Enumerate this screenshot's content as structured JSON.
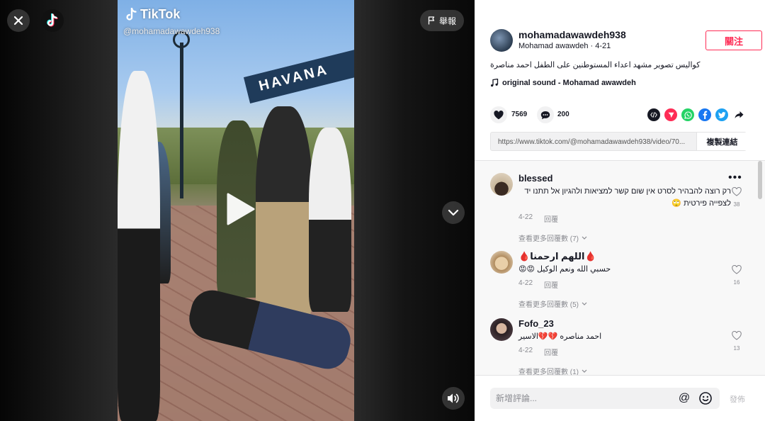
{
  "video": {
    "watermark_brand": "TikTok",
    "watermark_user": "@mohamadawawdeh938",
    "banner_text": "HAVANA",
    "report_label": "舉報"
  },
  "post": {
    "author_username": "mohamadawawdeh938",
    "author_display": "Mohamad awawdeh · 4-21",
    "follow_label": "關注",
    "caption": "كواليس تصوير مشهد اعداء المستوطنين على الطفل احمد مناصرة",
    "music": "original sound - Mohamad awawdeh",
    "likes": "7569",
    "comments": "200",
    "link_url": "https://www.tiktok.com/@mohamadawawdeh938/video/70...",
    "copy_label": "複製連結"
  },
  "share_icons": [
    {
      "name": "embed-icon",
      "color": "#161823"
    },
    {
      "name": "send-icon",
      "color": "#fe2c55"
    },
    {
      "name": "whatsapp-icon",
      "color": "#25d366"
    },
    {
      "name": "facebook-icon",
      "color": "#1877f2"
    },
    {
      "name": "twitter-icon",
      "color": "#1da1f2"
    },
    {
      "name": "share-arrow-icon",
      "color": "#161823"
    }
  ],
  "comments": [
    {
      "name": "blessed",
      "text": "רק רוצה להבהיר לסרט אין שום קשר למציאות ולהגיון אל תתנו יד לצפייה פירטית 🙄",
      "date": "4-22",
      "reply_label": "回覆",
      "likes": "38",
      "more": "查看更多回覆數 (7)"
    },
    {
      "name": "🩸اللهم ارحمنا🩸",
      "text": "حسبي الله ونعم الوكيل 😡😡",
      "date": "4-22",
      "reply_label": "回覆",
      "likes": "16",
      "more": "查看更多回覆數 (5)"
    },
    {
      "name": "Fofo_23",
      "text": "احمد مناصره 💔💔الاسير",
      "date": "4-22",
      "reply_label": "回覆",
      "likes": "13",
      "more": "查看更多回覆數 (1)"
    }
  ],
  "composer": {
    "placeholder": "新增評論...",
    "post_label": "發佈"
  }
}
